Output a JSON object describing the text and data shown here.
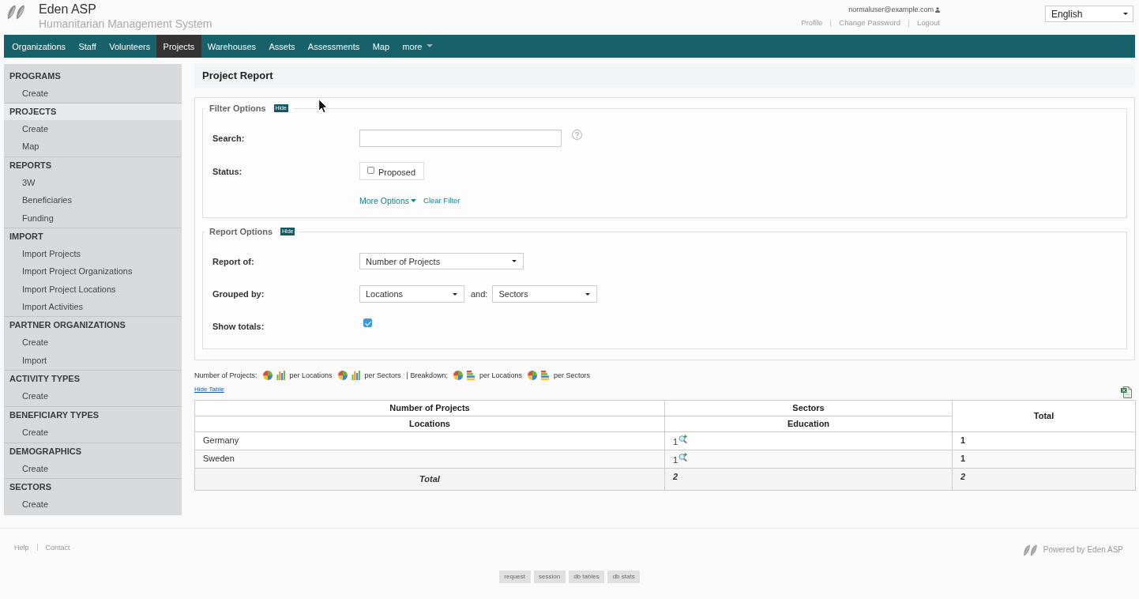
{
  "header": {
    "title": "Eden ASP",
    "subtitle": "Humanitarian Management System",
    "user": "normaluser@example.com",
    "user_links": [
      "Profile",
      "Change Password",
      "Logout"
    ],
    "language": "English"
  },
  "nav": [
    {
      "label": "Organizations",
      "kind": "link",
      "selected": false
    },
    {
      "label": "Staff",
      "kind": "link",
      "selected": false
    },
    {
      "label": "Volunteers",
      "kind": "link",
      "selected": false
    },
    {
      "label": "Projects",
      "kind": "link",
      "selected": true
    },
    {
      "label": "Warehouses",
      "kind": "link",
      "selected": false
    },
    {
      "label": "Assets",
      "kind": "link",
      "selected": false
    },
    {
      "label": "Assessments",
      "kind": "link",
      "selected": false
    },
    {
      "label": "Map",
      "kind": "link",
      "selected": false
    },
    {
      "label": "more",
      "kind": "menu",
      "selected": false
    }
  ],
  "sidebar": [
    {
      "heading": "PROGRAMS",
      "selected": false,
      "items": [
        "Create"
      ]
    },
    {
      "heading": "PROJECTS",
      "selected": true,
      "items": [
        "Create",
        "Map"
      ]
    },
    {
      "heading": "REPORTS",
      "selected": false,
      "items": [
        "3W",
        "Beneficiaries",
        "Funding"
      ]
    },
    {
      "heading": "IMPORT",
      "selected": false,
      "items": [
        "Import Projects",
        "Import Project Organizations",
        "Import Project Locations",
        "Import Activities"
      ]
    },
    {
      "heading": "PARTNER ORGANIZATIONS",
      "selected": false,
      "items": [
        "Create",
        "Import"
      ]
    },
    {
      "heading": "ACTIVITY TYPES",
      "selected": false,
      "items": [
        "Create"
      ]
    },
    {
      "heading": "BENEFICIARY TYPES",
      "selected": false,
      "items": [
        "Create"
      ]
    },
    {
      "heading": "DEMOGRAPHICS",
      "selected": false,
      "items": [
        "Create"
      ]
    },
    {
      "heading": "SECTORS",
      "selected": false,
      "items": [
        "Create"
      ]
    }
  ],
  "page_title": "Project Report",
  "filter_options": {
    "legend": "Filter Options",
    "hide_button": "Hide",
    "search": {
      "label": "Search:"
    },
    "status": {
      "label": "Status:",
      "options": [
        {
          "label": "Proposed",
          "checked": false
        }
      ]
    },
    "more_options": "More Options",
    "clear_filter": "Clear Filter"
  },
  "report_options": {
    "legend": "Report Options",
    "hide_button": "Hide",
    "report_of": {
      "label": "Report of:",
      "value": "Number of Projects"
    },
    "grouped_by": {
      "label": "Grouped by:",
      "rows": "Locations",
      "joiner": "and:",
      "columns": "Sectors"
    },
    "show_totals": {
      "label": "Show totals:",
      "checked": true
    }
  },
  "chart_links": [
    {
      "title": "Number of Projects:",
      "links": [
        {
          "label": "per Locations",
          "kind": "bar"
        },
        {
          "label": "per Sectors",
          "kind": "bar"
        }
      ]
    },
    {
      "title": "| Breakdown:",
      "links": [
        {
          "label": "per Locations",
          "kind": "stacked"
        },
        {
          "label": "per Sectors",
          "kind": "stacked"
        }
      ]
    }
  ],
  "hide_table": "Hide Table",
  "table": {
    "fact": "Number of Projects",
    "column_dimension": "Sectors",
    "row_dimension": "Locations",
    "columns": [
      "Education"
    ],
    "total_label": "Total",
    "rows": [
      {
        "label": "Germany",
        "cells": [
          "1"
        ],
        "total": "1"
      },
      {
        "label": "Sweden",
        "cells": [
          "1"
        ],
        "total": "1"
      }
    ],
    "totals": {
      "label": "Total",
      "cells": [
        "2"
      ],
      "total": "2"
    }
  },
  "footer": {
    "links": [
      "Help",
      "Contact"
    ],
    "powered_by": "Powered by Eden ASP",
    "debug_buttons": [
      "request",
      "session",
      "db tables",
      "db stats"
    ]
  }
}
